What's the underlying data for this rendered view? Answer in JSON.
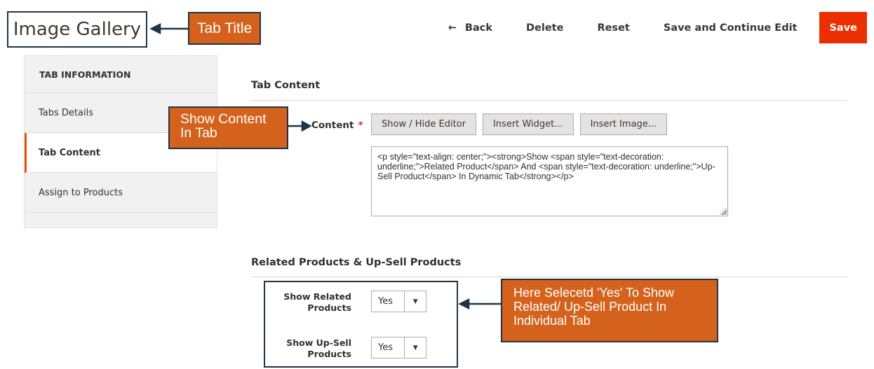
{
  "header": {
    "page_title": "Image Gallery",
    "actions": {
      "back": "Back",
      "delete": "Delete",
      "reset": "Reset",
      "save_continue": "Save and Continue Edit",
      "save": "Save"
    },
    "icons": {
      "back": "arrow-left-icon"
    }
  },
  "annotations": {
    "tab_title": "Tab Title",
    "show_content_line1": "Show Content",
    "show_content_line2": "In  Tab",
    "here_selected": "Here  Selecetd 'Yes' To Show Related/ Up-Sell Product In Individual Tab"
  },
  "sidebar": {
    "heading": "TAB INFORMATION",
    "items": [
      {
        "label": "Tabs Details",
        "active": false
      },
      {
        "label": "Tab Content",
        "active": true
      },
      {
        "label": "Assign to Products",
        "active": false
      }
    ]
  },
  "tab_content": {
    "section_title": "Tab Content",
    "content_label": "Content",
    "required_mark": "*",
    "editor_buttons": {
      "show_hide": "Show / Hide Editor",
      "insert_widget": "Insert Widget...",
      "insert_image": "Insert Image..."
    },
    "editor_value": "<p style=\"text-align: center;\"><strong>Show <span style=\"text-decoration: underline;\">Related Product</span> And <span style=\"text-decoration: underline;\">Up-Sell Product</span> In Dynamic Tab</strong></p>"
  },
  "related": {
    "section_title": "Related Products & Up-Sell Products",
    "show_related_label_1": "Show Related",
    "show_related_label_2": "Products",
    "show_related_value": "Yes",
    "show_upsell_label_1": "Show Up-Sell",
    "show_upsell_label_2": "Products",
    "show_upsell_value": "Yes"
  },
  "colors": {
    "accent": "#eb5202",
    "save_button": "#eb2f00",
    "callout_fill": "#d4621c",
    "callout_border": "#1f3547"
  }
}
